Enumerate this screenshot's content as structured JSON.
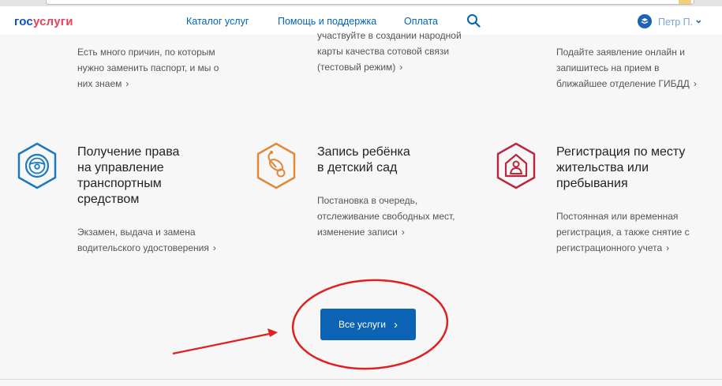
{
  "header": {
    "logo_part1": "гос",
    "logo_part2": "услуги",
    "nav": [
      "Каталог услуг",
      "Помощь и поддержка",
      "Оплата"
    ],
    "user_name": "Петр П.",
    "user_chevron": "⌄"
  },
  "partial_row": {
    "left_desc": [
      "Есть много причин, по которым",
      "нужно заменить паспорт, и мы о",
      "них знаем"
    ],
    "middle_top_cut": "участвуйте в создании народной",
    "middle_desc": [
      "карты качества сотовой связи",
      "(тестовый режим)"
    ],
    "right_desc": [
      "Подайте заявление онлайн и",
      "запишитесь на прием в",
      "ближайшее отделение ГИБДД"
    ]
  },
  "services": [
    {
      "icon": "steering-wheel-icon",
      "title": [
        "Получение права",
        "на управление",
        "транспортным",
        "средством"
      ],
      "desc": [
        "Экзамен, выдача и замена",
        "водительского удостоверения"
      ]
    },
    {
      "icon": "pacifier-icon",
      "title": [
        "Запись ребёнка",
        "в детский сад"
      ],
      "desc": [
        "Постановка в очередь,",
        "отслеживание свободных мест,",
        "изменение записи"
      ]
    },
    {
      "icon": "house-person-icon",
      "title": [
        "Регистрация по месту",
        "жительства или",
        "пребывания"
      ],
      "desc": [
        "Постоянная или временная",
        "регистрация, а также снятие с",
        "регистрационного учета"
      ]
    }
  ],
  "chevron": "›",
  "all_services_button": "Все услуги",
  "colors": {
    "brand_blue": "#0d4cd3",
    "brand_red": "#ee3f58",
    "link_blue": "#0065b1",
    "button_blue": "#0d63b3",
    "icon_blue": "#1b79c0",
    "icon_orange": "#e0893a",
    "icon_crimson": "#b8283f",
    "annotation_red": "#e02020"
  }
}
